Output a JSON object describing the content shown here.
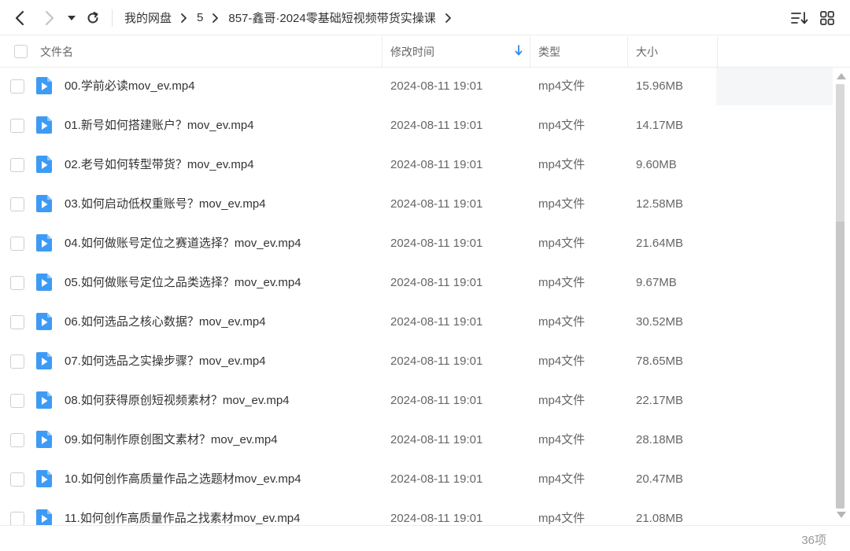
{
  "toolbar": {
    "breadcrumb": [
      "我的网盘",
      "5",
      "857-鑫哥·2024零基础短视频带货实操课"
    ]
  },
  "header": {
    "name": "文件名",
    "mtime": "修改时间",
    "type": "类型",
    "size": "大小"
  },
  "files": [
    {
      "name": "00.学前必读mov_ev.mp4",
      "mtime": "2024-08-11 19:01",
      "type": "mp4文件",
      "size": "15.96MB"
    },
    {
      "name": "01.新号如何搭建账户？mov_ev.mp4",
      "mtime": "2024-08-11 19:01",
      "type": "mp4文件",
      "size": "14.17MB"
    },
    {
      "name": "02.老号如何转型带货？mov_ev.mp4",
      "mtime": "2024-08-11 19:01",
      "type": "mp4文件",
      "size": "9.60MB"
    },
    {
      "name": "03.如何启动低权重账号？mov_ev.mp4",
      "mtime": "2024-08-11 19:01",
      "type": "mp4文件",
      "size": "12.58MB"
    },
    {
      "name": "04.如何做账号定位之赛道选择？mov_ev.mp4",
      "mtime": "2024-08-11 19:01",
      "type": "mp4文件",
      "size": "21.64MB"
    },
    {
      "name": "05.如何做账号定位之品类选择？mov_ev.mp4",
      "mtime": "2024-08-11 19:01",
      "type": "mp4文件",
      "size": "9.67MB"
    },
    {
      "name": "06.如何选品之核心数据？mov_ev.mp4",
      "mtime": "2024-08-11 19:01",
      "type": "mp4文件",
      "size": "30.52MB"
    },
    {
      "name": "07.如何选品之实操步骤？mov_ev.mp4",
      "mtime": "2024-08-11 19:01",
      "type": "mp4文件",
      "size": "78.65MB"
    },
    {
      "name": "08.如何获得原创短视频素材？mov_ev.mp4",
      "mtime": "2024-08-11 19:01",
      "type": "mp4文件",
      "size": "22.17MB"
    },
    {
      "name": "09.如何制作原创图文素材？mov_ev.mp4",
      "mtime": "2024-08-11 19:01",
      "type": "mp4文件",
      "size": "28.18MB"
    },
    {
      "name": "10.如何创作高质量作品之选题材mov_ev.mp4",
      "mtime": "2024-08-11 19:01",
      "type": "mp4文件",
      "size": "20.47MB"
    },
    {
      "name": "11.如何创作高质量作品之找素材mov_ev.mp4",
      "mtime": "2024-08-11 19:01",
      "type": "mp4文件",
      "size": "21.08MB"
    }
  ],
  "footer": {
    "count": "36项"
  },
  "colors": {
    "file_icon": "#3d9bf5",
    "sort_arrow": "#2f8cf0"
  },
  "icons": [
    "back-arrow-icon",
    "forward-arrow-icon",
    "history-dropdown-icon",
    "refresh-icon",
    "sort-icon",
    "grid-view-icon",
    "video-file-icon"
  ]
}
